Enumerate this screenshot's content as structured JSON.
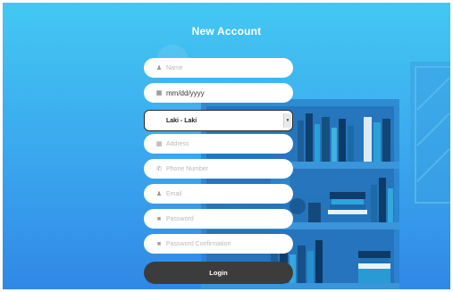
{
  "form": {
    "title": "New Account",
    "fields": [
      {
        "placeholder": "Name",
        "icon": "user-icon"
      },
      {
        "value": "mm/dd/yyyy",
        "icon": "calendar-icon"
      },
      {
        "value": "Laki - Laki",
        "type": "select"
      },
      {
        "placeholder": "Address",
        "icon": "map-icon"
      },
      {
        "placeholder": "Phone Number",
        "icon": "phone-icon"
      },
      {
        "placeholder": "Email",
        "icon": "user-icon"
      },
      {
        "placeholder": "Password",
        "icon": "lock-icon"
      },
      {
        "placeholder": "Password Confirmation",
        "icon": "lock-icon"
      }
    ],
    "login_label": "Login"
  },
  "colors": {
    "background_top": "#43c8f2",
    "background_bottom": "#3088e6",
    "button": "#3c3c3c",
    "field": "#ffffff"
  }
}
